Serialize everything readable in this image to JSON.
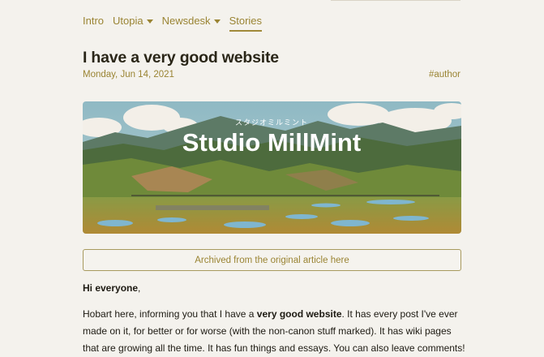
{
  "nav": {
    "items": [
      {
        "label": "Intro",
        "has_dropdown": false
      },
      {
        "label": "Utopia",
        "has_dropdown": true
      },
      {
        "label": "Newsdesk",
        "has_dropdown": true
      },
      {
        "label": "Stories",
        "has_dropdown": false,
        "active": true
      }
    ]
  },
  "post": {
    "title": "I have a very good website",
    "date": "Monday, Jun 14, 2021",
    "tag": "#author",
    "banner": {
      "title": "Studio MillMint",
      "subtitle": "スタジオミルミント"
    },
    "archive_link": "Archived from the original article here",
    "greeting_bold": "Hi everyone",
    "greeting_tail": ",",
    "para": {
      "p1": "Hobart here, informing you that I have a ",
      "bold": "very good website",
      "p2": ". It has every post I've ever made on it, for better or for worse (with the non-canon stuff marked). It has wiki pages that are growing all the time. It has fun things and essays. You can also leave comments!"
    }
  },
  "colors": {
    "background": "#f4f2ed",
    "accent": "#9a8433",
    "text": "#1d1a12"
  }
}
